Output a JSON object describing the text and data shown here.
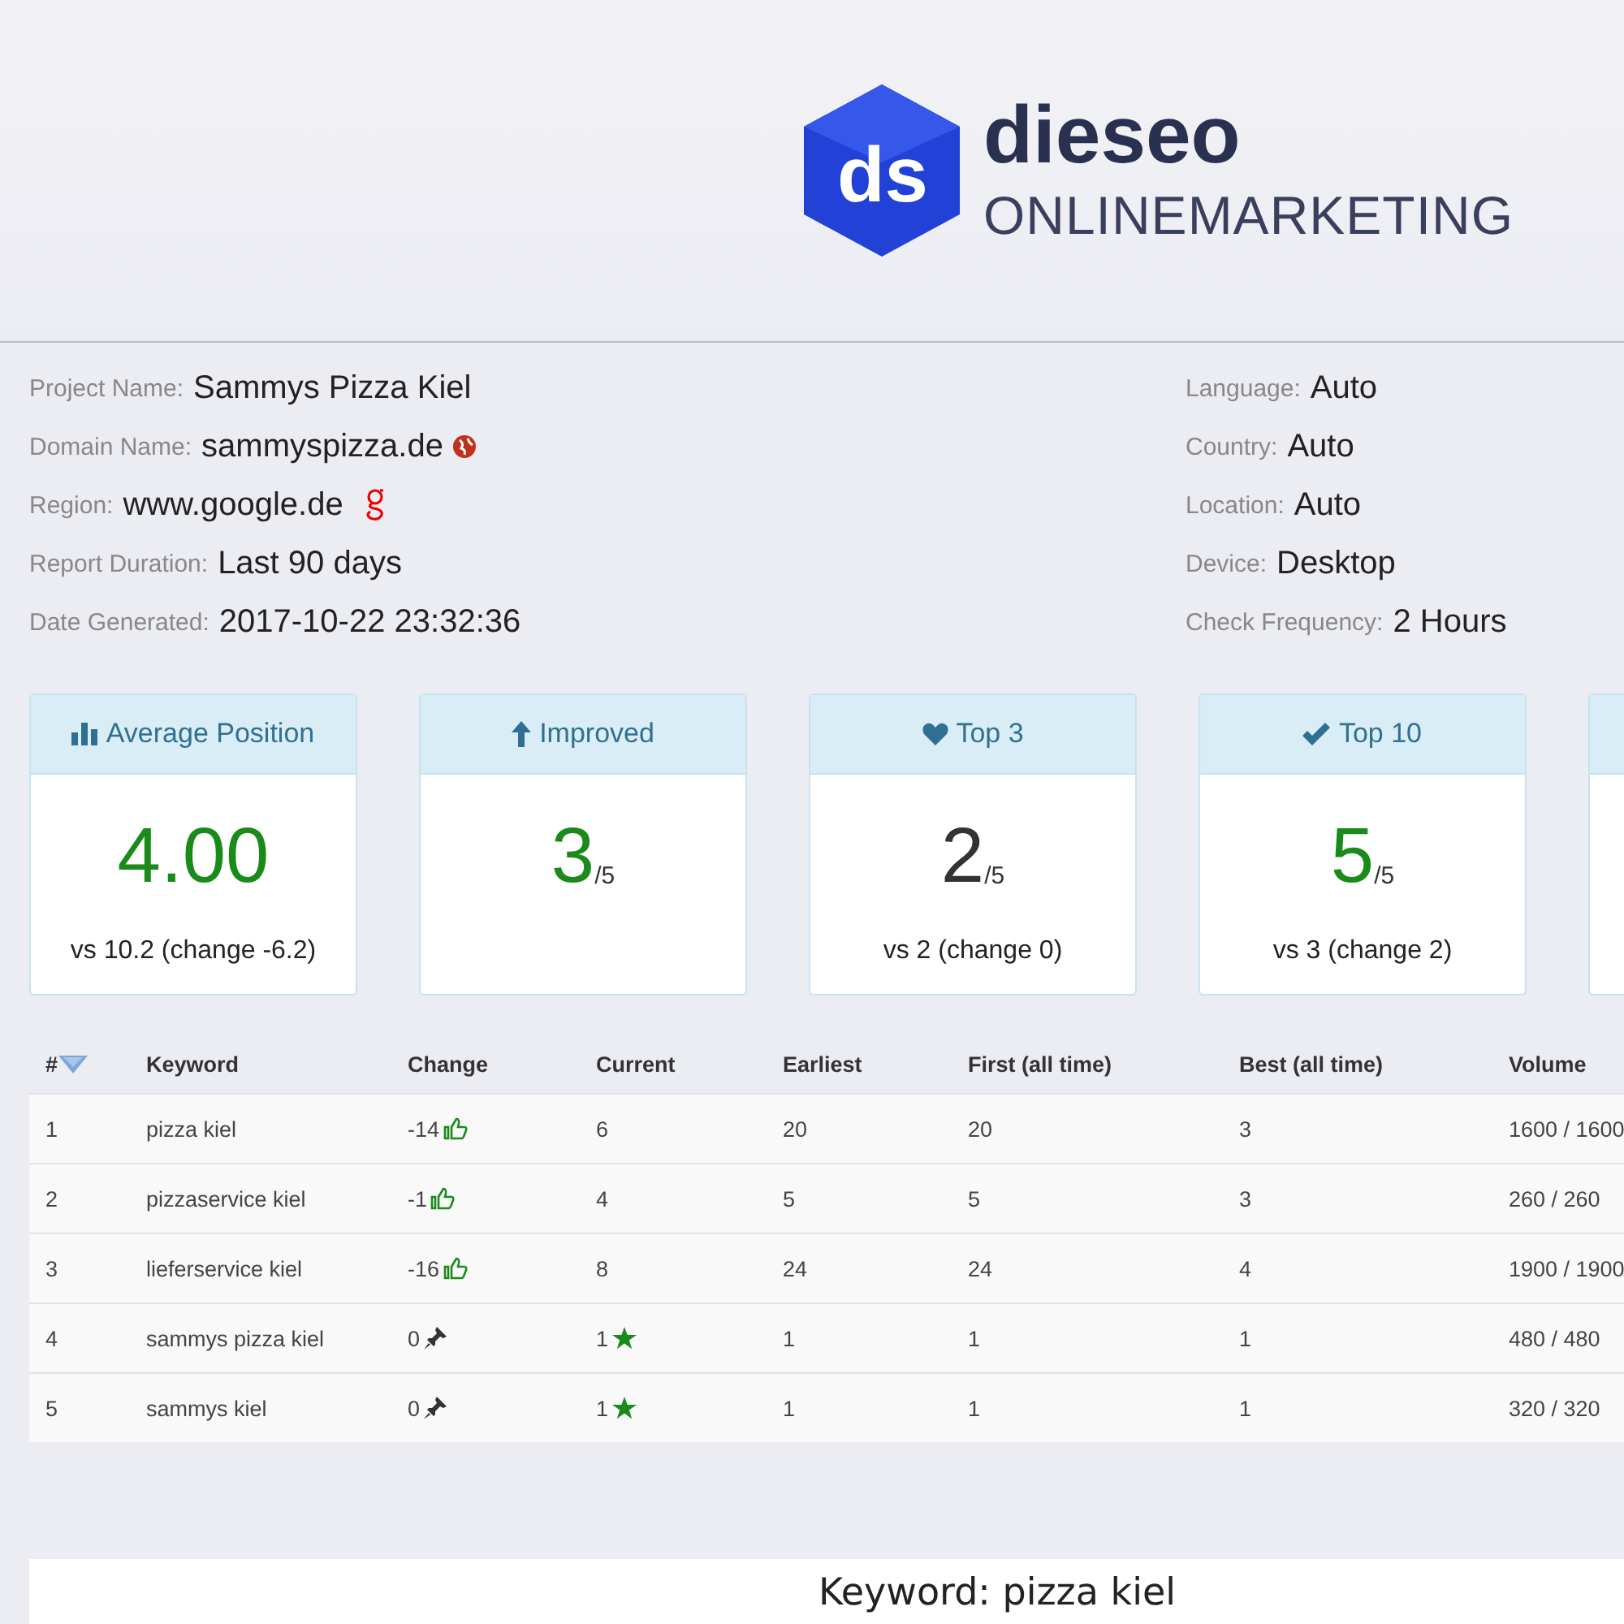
{
  "logo": {
    "mark": "ds",
    "name": "dieseo",
    "tagline": "ONLINEMARKETING"
  },
  "project_info": [
    {
      "label": "Project Name:",
      "value": "Sammys Pizza Kiel"
    },
    {
      "label": "Domain Name:",
      "value": "sammyspizza.de",
      "kind": "globe"
    },
    {
      "label": "Region:",
      "value": "www.google.de",
      "kind": "google"
    },
    {
      "label": "Report Duration:",
      "value": "Last 90 days"
    },
    {
      "label": "Date Generated:",
      "value": "2017-10-22 23:32:36"
    }
  ],
  "settings_info": [
    {
      "label": "Language:",
      "value": "Auto"
    },
    {
      "label": "Country:",
      "value": "Auto"
    },
    {
      "label": "Location:",
      "value": "Auto"
    },
    {
      "label": "Device:",
      "value": "Desktop"
    },
    {
      "label": "Check Frequency:",
      "value": "2 Hours"
    }
  ],
  "cards": [
    {
      "kind": "bar-chart",
      "title": "Average Position",
      "value": "4.00",
      "color": "#1a8a1a",
      "comparison": "vs 10.2 (change -6.2)"
    },
    {
      "kind": "arrow-up",
      "title": "Improved",
      "value": "3",
      "total": "/5",
      "color": "#1a8a1a"
    },
    {
      "kind": "heart",
      "title": "Top 3",
      "value": "2",
      "total": "/5",
      "color": "#333333",
      "comparison": "vs 2 (change 0)"
    },
    {
      "kind": "check",
      "title": "Top 10",
      "value": "5",
      "total": "/5",
      "color": "#1a8a1a",
      "comparison": "vs 3 (change 2)"
    }
  ],
  "table": {
    "columns": [
      "#",
      "Keyword",
      "Change",
      "Current",
      "Earliest",
      "First (all time)",
      "Best (all time)",
      "Volume"
    ],
    "rows": [
      {
        "cells": [
          "1",
          "pizza kiel",
          "-14",
          "6",
          "20",
          "20",
          "3",
          "1600 / 1600"
        ],
        "kind": "thumbs-up",
        "star": false
      },
      {
        "cells": [
          "2",
          "pizzaservice kiel",
          "-1",
          "4",
          "5",
          "5",
          "3",
          "260 / 260"
        ],
        "kind": "thumbs-up",
        "star": false
      },
      {
        "cells": [
          "3",
          "lieferservice kiel",
          "-16",
          "8",
          "24",
          "24",
          "4",
          "1900 / 1900"
        ],
        "kind": "thumbs-up",
        "star": false
      },
      {
        "cells": [
          "4",
          "sammys pizza kiel",
          "0",
          "1",
          "1",
          "1",
          "1",
          "480 / 480"
        ],
        "kind": "pin",
        "star": true
      },
      {
        "cells": [
          "5",
          "sammys kiel",
          "0",
          "1",
          "1",
          "1",
          "1",
          "320 / 320"
        ],
        "kind": "pin",
        "star": true
      }
    ]
  },
  "detail": {
    "title": "Keyword: pizza kiel"
  }
}
